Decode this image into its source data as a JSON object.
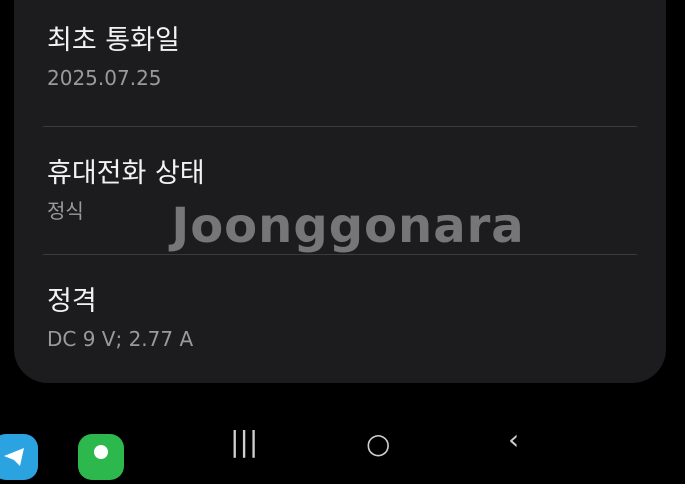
{
  "settings": {
    "rows": [
      {
        "title": "최초 통화일",
        "value": "2025.07.25"
      },
      {
        "title": "휴대전화 상태",
        "value": "정식"
      },
      {
        "title": "정격",
        "value": "DC 9 V; 2.77 A"
      }
    ]
  },
  "watermark": {
    "text": "Joonggonara"
  },
  "navbar": {
    "recents_icon": "|||",
    "home_icon": "○",
    "back_icon": "‹"
  },
  "colors": {
    "background": "#000000",
    "card": "#1c1c1e",
    "title": "#f2f2f2",
    "subtitle": "#9a9a9a",
    "divider": "#3a3a3d",
    "telegram_app": "#2aa3e0",
    "green_app": "#2db84d"
  }
}
